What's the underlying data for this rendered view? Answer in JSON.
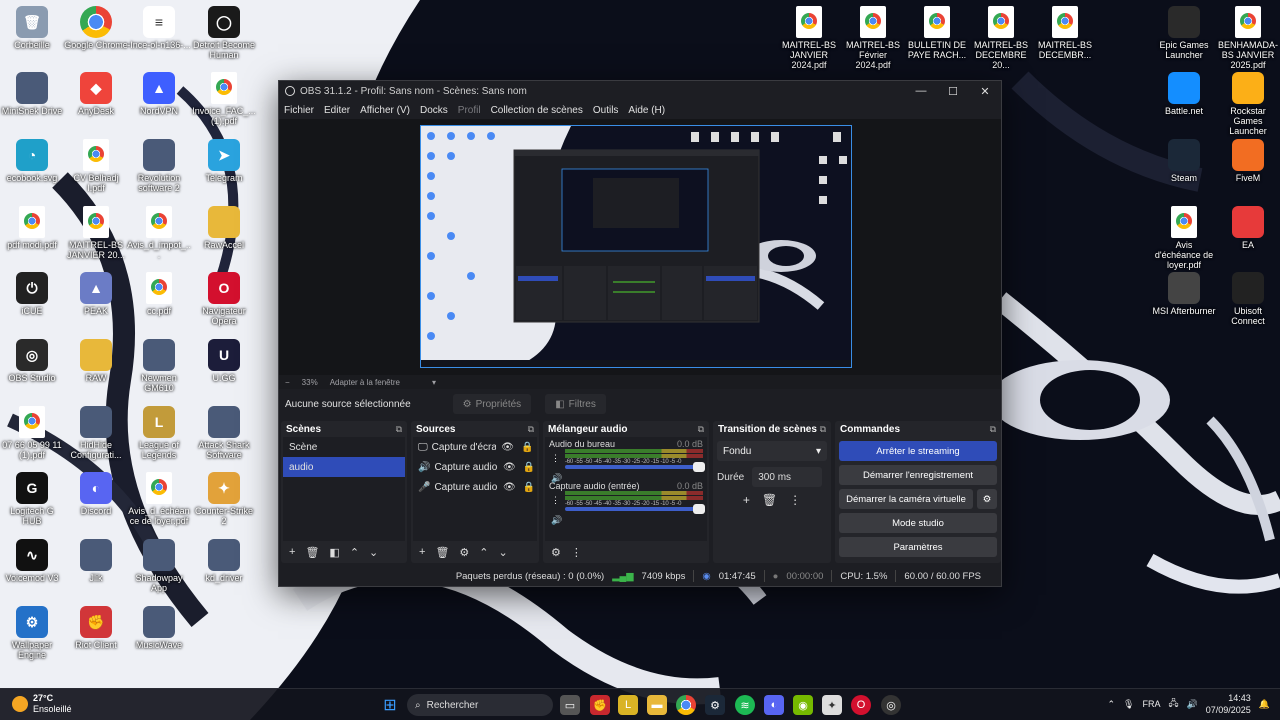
{
  "desktop": {
    "icons_left": [
      {
        "label": "Corbeille",
        "icon": "recycle-bin-icon"
      },
      {
        "label": "Google Chrome",
        "icon": "chrome-icon"
      },
      {
        "label": "-Ince-ol-n136-...",
        "icon": "file-icon"
      },
      {
        "label": "Detroit Become Human",
        "icon": "detroit-icon"
      },
      {
        "label": "MiniSnek Drive",
        "icon": "app-icon"
      },
      {
        "label": "AnyDesk",
        "icon": "anydesk-icon"
      },
      {
        "label": "NordVPN",
        "icon": "nordvpn-icon"
      },
      {
        "label": "Invoice_FAC_... (1).pdf",
        "icon": "pdf-icon"
      },
      {
        "label": "ecobook.svg",
        "icon": "edge-icon"
      },
      {
        "label": "CV Belhadj I.pdf",
        "icon": "pdf-icon"
      },
      {
        "label": "Revolution software 2",
        "icon": "app-icon"
      },
      {
        "label": "Telegram",
        "icon": "telegram-icon"
      },
      {
        "label": "pdf modi.pdf",
        "icon": "pdf-icon"
      },
      {
        "label": "MAITREL-BS JANVIER 20...",
        "icon": "pdf-icon"
      },
      {
        "label": "Avis_d_impot_...",
        "icon": "pdf-icon"
      },
      {
        "label": "RawAccel",
        "icon": "folder-icon"
      },
      {
        "label": "iCUE",
        "icon": "icue-icon"
      },
      {
        "label": "PEAK",
        "icon": "peak-icon"
      },
      {
        "label": "cc.pdf",
        "icon": "pdf-icon"
      },
      {
        "label": "Navigateur Opera",
        "icon": "opera-icon"
      },
      {
        "label": "OBS Studio",
        "icon": "obs-icon"
      },
      {
        "label": "RAW",
        "icon": "folder-icon"
      },
      {
        "label": "Newmen GM610",
        "icon": "app-icon"
      },
      {
        "label": "U.GG",
        "icon": "ugg-icon"
      },
      {
        "label": "07 66 05 99 11 (1).pdf",
        "icon": "pdf-icon"
      },
      {
        "label": "HidHide Configurati...",
        "icon": "app-icon"
      },
      {
        "label": "League of Legends",
        "icon": "lol-icon"
      },
      {
        "label": "Attack Shark Software",
        "icon": "app-icon"
      },
      {
        "label": "Logitech G HUB",
        "icon": "ghub-icon"
      },
      {
        "label": "Discord",
        "icon": "discord-icon"
      },
      {
        "label": "Avis_d_échéance de loyer.pdf",
        "icon": "pdf-icon"
      },
      {
        "label": "Counter-Strike 2",
        "icon": "cs2-icon"
      },
      {
        "label": "Voicemod V3",
        "icon": "voicemod-icon"
      },
      {
        "label": "Jlik",
        "icon": "app-icon"
      },
      {
        "label": "Shadowpay App",
        "icon": "app-icon"
      },
      {
        "label": "kd_driver",
        "icon": "app-icon"
      },
      {
        "label": "Wallpaper Engine",
        "icon": "wallpaper-icon"
      },
      {
        "label": "Riot Client",
        "icon": "riot-icon"
      },
      {
        "label": "MusicWave",
        "icon": "app-icon"
      }
    ],
    "icons_top": [
      {
        "label": "MAITREL-BS JANVIER 2024.pdf"
      },
      {
        "label": "MAITREL-BS Février 2024.pdf"
      },
      {
        "label": "BULLETIN DE PAYE RACH..."
      },
      {
        "label": "MAITREL-BS DECEMBRE 20..."
      },
      {
        "label": "MAITREL-BS DECEMBR..."
      }
    ],
    "icons_right": [
      {
        "label": "Epic Games Launcher",
        "icon": "epic-icon"
      },
      {
        "label": "BENHAMADA-BS JANVIER 2025.pdf",
        "icon": "pdf-icon"
      },
      {
        "label": "Battle.net",
        "icon": "battlenet-icon"
      },
      {
        "label": "Rockstar Games Launcher",
        "icon": "rockstar-icon"
      },
      {
        "label": "Steam",
        "icon": "steam-icon"
      },
      {
        "label": "FiveM",
        "icon": "fivem-icon"
      },
      {
        "label": "Avis d'échéance de loyer.pdf",
        "icon": "pdf-icon"
      },
      {
        "label": "EA",
        "icon": "ea-icon"
      },
      {
        "label": "MSI Afterburner",
        "icon": "msi-icon"
      },
      {
        "label": "Ubisoft Connect",
        "icon": "ubisoft-icon"
      }
    ]
  },
  "obs": {
    "title": "OBS 31.1.2 - Profil: Sans nom - Scènes: Sans nom",
    "menu": [
      "Fichier",
      "Editer",
      "Afficher (V)",
      "Docks",
      "Profil",
      "Collection de scènes",
      "Outils",
      "Aide (H)"
    ],
    "zoom": {
      "minus": "−",
      "value": "33%",
      "fit": "Adapter à la fenêtre"
    },
    "source_bar": {
      "none_selected": "Aucune source sélectionnée",
      "properties": "Propriétés",
      "filters": "Filtres"
    },
    "scenes": {
      "title": "Scènes",
      "items": [
        "Scène",
        "audio"
      ]
    },
    "sources": {
      "title": "Sources",
      "items": [
        "Capture d'écran",
        "Capture audio (so",
        "Capture audio (e"
      ]
    },
    "mixer": {
      "title": "Mélangeur audio",
      "scale": "-60 -55 -50 -45 -40 -35 -30 -25 -20 -15 -10 -5 -0",
      "channels": [
        {
          "name": "Audio du bureau",
          "db": "0.0 dB"
        },
        {
          "name": "Capture audio (entrée)",
          "db": "0.0 dB"
        }
      ]
    },
    "transition": {
      "title": "Transition de scènes",
      "type": "Fondu",
      "duration_label": "Durée",
      "duration": "300 ms"
    },
    "commands": {
      "title": "Commandes",
      "stop_stream": "Arrêter le streaming",
      "start_record": "Démarrer l'enregistrement",
      "start_virtualcam": "Démarrer la caméra virtuelle",
      "studio_mode": "Mode studio",
      "settings": "Paramètres"
    },
    "status": {
      "dropped": "Paquets perdus (réseau) : 0 (0.0%)",
      "bitrate": "7409 kbps",
      "stream_time": "01:47:45",
      "record_time": "00:00:00",
      "cpu": "CPU: 1.5%",
      "fps": "60.00 / 60.00 FPS"
    }
  },
  "taskbar": {
    "weather_temp": "27°C",
    "weather_desc": "Ensoleillé",
    "search_placeholder": "Rechercher",
    "language": "FRA",
    "time": "14:43",
    "date": "07/09/2025"
  }
}
